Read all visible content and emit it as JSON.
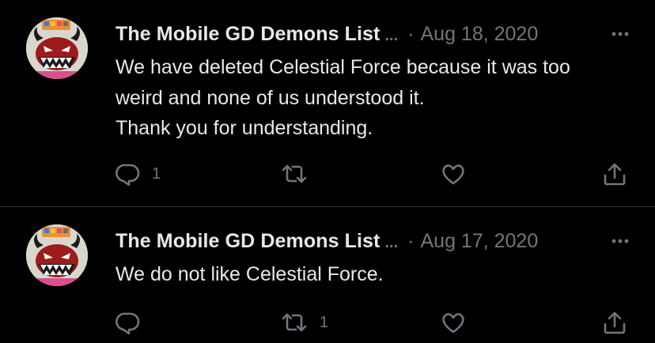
{
  "colors": {
    "background": "#000000",
    "text_primary": "#e7e9ea",
    "text_secondary": "#71767b",
    "divider": "#2f3336"
  },
  "tweets": [
    {
      "author": "The Mobile GD Demons List",
      "ellipsis": "...",
      "separator": "·",
      "date": "Aug 18, 2020",
      "text_lines": [
        "We have deleted Celestial Force because it was too",
        "weird and none of us understood it.",
        "Thank you for understanding."
      ],
      "reply_count": "1",
      "retweet_count": "",
      "like_count": "",
      "icons": [
        "reply-icon",
        "retweet-icon",
        "like-icon",
        "share-icon",
        "more-icon"
      ]
    },
    {
      "author": "The Mobile GD Demons List",
      "ellipsis": "...",
      "separator": "·",
      "date": "Aug 17, 2020",
      "text_lines": [
        "We do not like Celestial Force."
      ],
      "reply_count": "",
      "retweet_count": "1",
      "like_count": "",
      "icons": [
        "reply-icon",
        "retweet-icon",
        "like-icon",
        "share-icon",
        "more-icon"
      ]
    }
  ]
}
